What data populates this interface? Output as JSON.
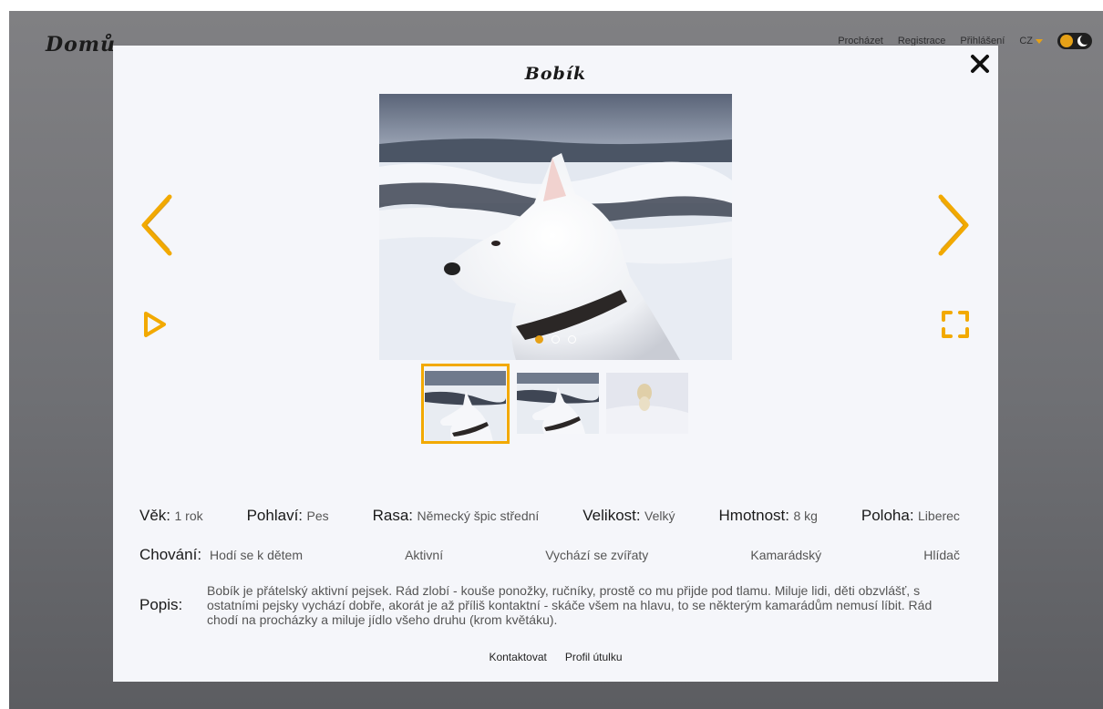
{
  "site": {
    "logo": "Domů",
    "nav": {
      "browse": "Procházet",
      "register": "Registrace",
      "login": "Přihlášení",
      "language": "CZ"
    }
  },
  "modal": {
    "title": "Bobík",
    "photo_count": 3,
    "active_photo": 1,
    "attributes": [
      {
        "label": "Věk:",
        "value": "1 rok"
      },
      {
        "label": "Pohlaví:",
        "value": "Pes"
      },
      {
        "label": "Rasa:",
        "value": "Německý špic střední"
      },
      {
        "label": "Velikost:",
        "value": "Velký"
      },
      {
        "label": "Hmotnost:",
        "value": "8 kg"
      },
      {
        "label": "Poloha:",
        "value": "Liberec"
      }
    ],
    "behaviour": {
      "label": "Chování:",
      "items": [
        "Hodí se k dětem",
        "Aktivní",
        "Vychází se zvířaty",
        "Kamarádský",
        "Hlídač"
      ]
    },
    "description": {
      "label": "Popis:",
      "text": "Bobík je přátelský aktivní pejsek. Rád zlobí - kouše ponožky, ručníky, prostě co mu přijde pod tlamu. Miluje lidi, děti obzvlášť, s ostatními pejsky vychází dobře, akorát je až příliš kontaktní - skáče všem na hlavu, to se některým kamarádům nemusí líbit. Rád chodí na procházky a miluje jídlo všeho druhu (krom květáku)."
    },
    "links": {
      "contact": "Kontaktovat",
      "shelter_profile": "Profil útulku"
    }
  },
  "colors": {
    "accent": "#f2a900",
    "overlay": "#707175",
    "modal_bg": "#f5f6fa"
  },
  "icons": [
    "close-icon",
    "chevron-left-icon",
    "chevron-right-icon",
    "play-icon",
    "fullscreen-icon"
  ]
}
